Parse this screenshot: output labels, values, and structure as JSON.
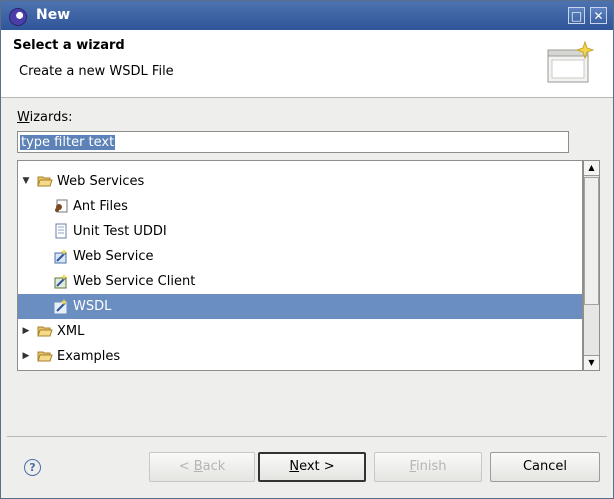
{
  "window": {
    "title": "New",
    "buttons": {
      "maximize_glyph": "□",
      "close_glyph": "✕"
    }
  },
  "header": {
    "title": "Select a wizard",
    "description": "Create a new WSDL File"
  },
  "wizards": {
    "label_prefix": "",
    "label_mnemonic": "W",
    "label_rest": "izards:",
    "filter_placeholder": "type filter text"
  },
  "tree": {
    "items": [
      {
        "label": "Web Services",
        "icon": "folder-open-icon",
        "expanded": true,
        "depth": 0
      },
      {
        "label": "Ant Files",
        "icon": "ant-files-icon",
        "depth": 1
      },
      {
        "label": "Unit Test UDDI",
        "icon": "document-icon",
        "depth": 1
      },
      {
        "label": "Web Service",
        "icon": "web-service-icon",
        "depth": 1
      },
      {
        "label": "Web Service Client",
        "icon": "web-service-client-icon",
        "depth": 1
      },
      {
        "label": "WSDL",
        "icon": "wsdl-icon",
        "depth": 1,
        "selected": true
      },
      {
        "label": "XML",
        "icon": "folder-icon",
        "expanded": false,
        "depth": 0
      },
      {
        "label": "Examples",
        "icon": "folder-icon",
        "expanded": false,
        "depth": 0
      }
    ]
  },
  "footer": {
    "help_glyph": "?",
    "back": {
      "prefix": "< ",
      "mnemonic": "B",
      "rest": "ack",
      "enabled": false
    },
    "next": {
      "prefix": "",
      "mnemonic": "N",
      "rest": "ext >",
      "enabled": true
    },
    "finish": {
      "prefix": "",
      "mnemonic": "F",
      "rest": "inish",
      "enabled": false
    },
    "cancel": {
      "label": "Cancel",
      "enabled": true
    }
  },
  "colors": {
    "titlebar": "#3c62a3",
    "selection": "#6a8ebf"
  }
}
